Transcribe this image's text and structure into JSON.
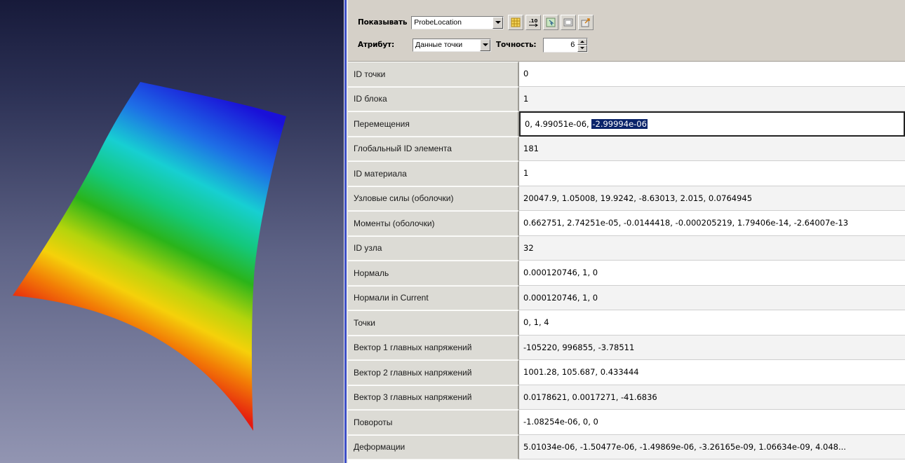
{
  "toolbar": {
    "show_label": "Показывать",
    "show_value": "ProbeLocation",
    "attribute_label": "Атрибут:",
    "attribute_value": "Данные точки",
    "precision_label": "Точность:",
    "precision_value": "6",
    "tool_icons": [
      "grid-icon",
      "decimal-icon",
      "select-icon",
      "copy-icon",
      "export-icon"
    ]
  },
  "properties": [
    {
      "name": "ID точки",
      "value": "0"
    },
    {
      "name": "ID блока",
      "value": "1"
    },
    {
      "name": "Перемещения",
      "value_plain": "0, 4.99051e-06, ",
      "value_selected": "-2.99994e-06"
    },
    {
      "name": "Глобальный ID элемента",
      "value": "181"
    },
    {
      "name": "ID материала",
      "value": "1"
    },
    {
      "name": "Узловые силы (оболочки)",
      "value": "20047.9, 1.05008, 19.9242, -8.63013, 2.015, 0.0764945"
    },
    {
      "name": "Моменты (оболочки)",
      "value": "0.662751, 2.74251e-05, -0.0144418, -0.000205219, 1.79406e-14, -2.64007e-13"
    },
    {
      "name": "ID узла",
      "value": "32"
    },
    {
      "name": "Нормаль",
      "value": "0.000120746, 1, 0"
    },
    {
      "name": "Нормали in Current",
      "value": "0.000120746, 1, 0"
    },
    {
      "name": "Точки",
      "value": "0, 1, 4"
    },
    {
      "name": "Вектор 1 главных напряжений",
      "value": "-105220, 996855, -3.78511"
    },
    {
      "name": "Вектор 2 главных напряжений",
      "value": "1001.28, 105.687, 0.433444"
    },
    {
      "name": "Вектор 3 главных напряжений",
      "value": "0.0178621, 0.0017271, -41.6836"
    },
    {
      "name": "Повороты",
      "value": "-1.08254e-06, 0, 0"
    },
    {
      "name": "Деформации",
      "value": "5.01034e-06, -1.50477e-06, -1.49869e-06, -3.26165e-09, 1.06634e-09, 4.048..."
    }
  ],
  "colors": {
    "accent": "#3e4fc8",
    "selection": "#0a246a",
    "viewport_top": "#171a3a",
    "viewport_bottom": "#9295b2"
  }
}
